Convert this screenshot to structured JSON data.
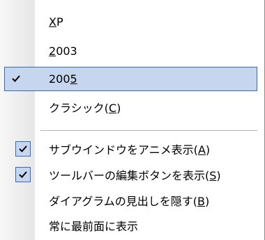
{
  "menu": {
    "items": [
      {
        "pre": "",
        "mn": "X",
        "post": "P",
        "checked": false
      },
      {
        "pre": "",
        "mn": "2",
        "post": "003",
        "checked": false
      },
      {
        "pre": "200",
        "mn": "5",
        "post": "",
        "checked": true,
        "selected": true
      },
      {
        "pre": "クラシック(",
        "mn": "C",
        "post": ")",
        "checked": false
      },
      {
        "pre": "サブウインドウをアニメ表示(",
        "mn": "A",
        "post": ")",
        "checked": true
      },
      {
        "pre": "ツールバーの編集ボタンを表示(",
        "mn": "S",
        "post": ")",
        "checked": true
      },
      {
        "pre": "ダイアグラムの見出しを隠す(",
        "mn": "B",
        "post": ")",
        "checked": false
      },
      {
        "pre": "常に最前面に表示",
        "mn": "",
        "post": "",
        "checked": false
      }
    ],
    "icons": {
      "check": "checkmark-icon"
    }
  }
}
